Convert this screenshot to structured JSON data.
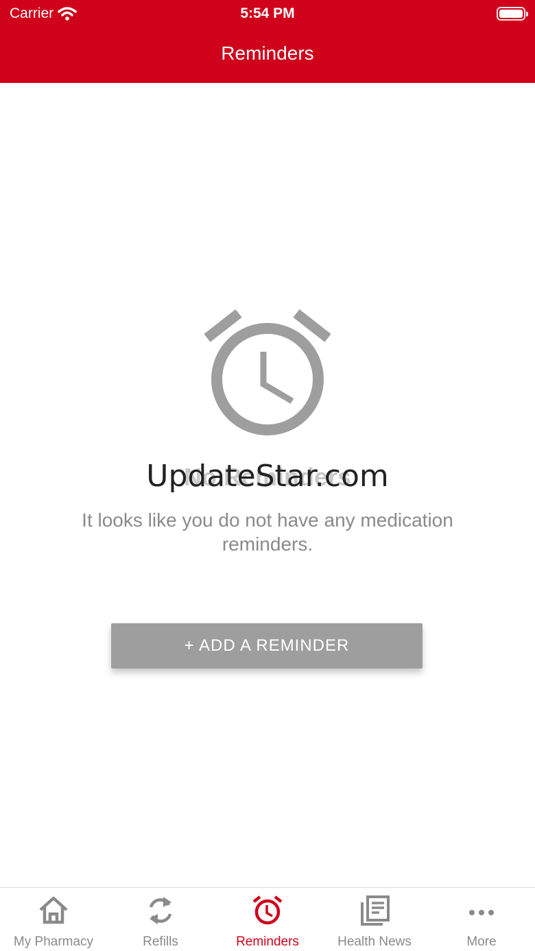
{
  "status_bar": {
    "carrier": "Carrier",
    "time": "5:54 PM"
  },
  "header": {
    "title": "Reminders"
  },
  "empty_state": {
    "icon": "alarm-clock-icon",
    "watermark": "UpdateStar.com",
    "title": "No Reminders",
    "description": "It looks like you do not have any medication reminders."
  },
  "add_button": {
    "label": "+ ADD A REMINDER"
  },
  "tabs": [
    {
      "label": "My Pharmacy",
      "icon": "home-icon"
    },
    {
      "label": "Refills",
      "icon": "refresh-icon"
    },
    {
      "label": "Reminders",
      "icon": "alarm-icon"
    },
    {
      "label": "Health News",
      "icon": "news-icon"
    },
    {
      "label": "More",
      "icon": "more-dots-icon"
    }
  ],
  "colors": {
    "brand_red": "#d0021b",
    "muted_gray": "#9e9e9e",
    "tab_gray": "#8a8a8a"
  },
  "active_tab": "Reminders"
}
